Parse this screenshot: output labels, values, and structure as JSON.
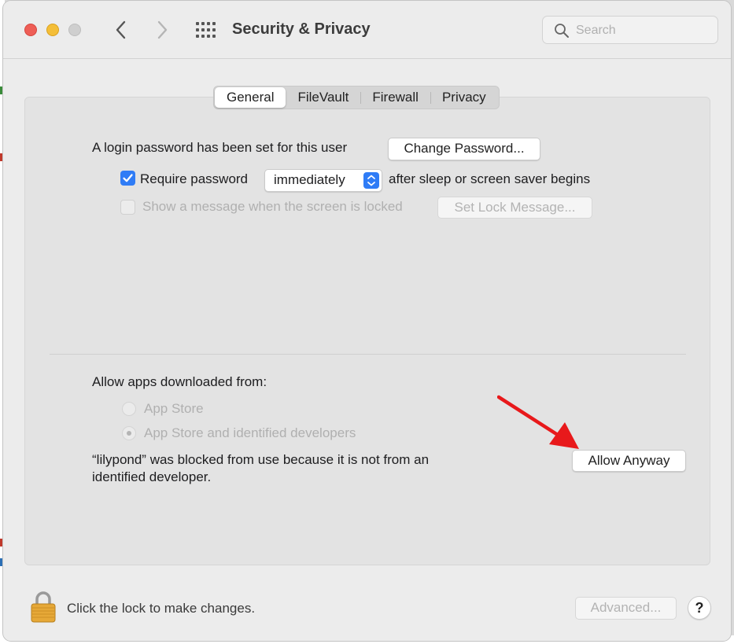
{
  "window": {
    "title": "Security & Privacy",
    "search_placeholder": "Search"
  },
  "tabs": [
    {
      "label": "General",
      "active": true
    },
    {
      "label": "FileVault",
      "active": false
    },
    {
      "label": "Firewall",
      "active": false
    },
    {
      "label": "Privacy",
      "active": false
    }
  ],
  "general": {
    "login_text": "A login password has been set for this user",
    "change_password_label": "Change Password...",
    "require_password_label": "Require password",
    "require_password_checked": true,
    "require_password_delay": "immediately",
    "after_sleep_text": "after sleep or screen saver begins",
    "show_message_label": "Show a message when the screen is locked",
    "show_message_checked": false,
    "set_lock_message_label": "Set Lock Message..."
  },
  "apps": {
    "heading": "Allow apps downloaded from:",
    "options": [
      {
        "label": "App Store",
        "selected": false
      },
      {
        "label": "App Store and identified developers",
        "selected": true
      }
    ],
    "blocked_line1": "“lilypond” was blocked from use because it is not from an",
    "blocked_line2": "identified developer.",
    "allow_anyway_label": "Allow Anyway"
  },
  "footer": {
    "lock_text": "Click the lock to make changes.",
    "advanced_label": "Advanced...",
    "help_label": "?"
  },
  "colors": {
    "accent": "#2f7cf6",
    "annotation_arrow": "#e8191b"
  },
  "icons": [
    "chevron-left-icon",
    "chevron-right-icon",
    "grid-icon",
    "search-icon",
    "checkmark-icon",
    "up-down-chevron-icon",
    "lock-icon",
    "arrow-annotation-icon"
  ]
}
